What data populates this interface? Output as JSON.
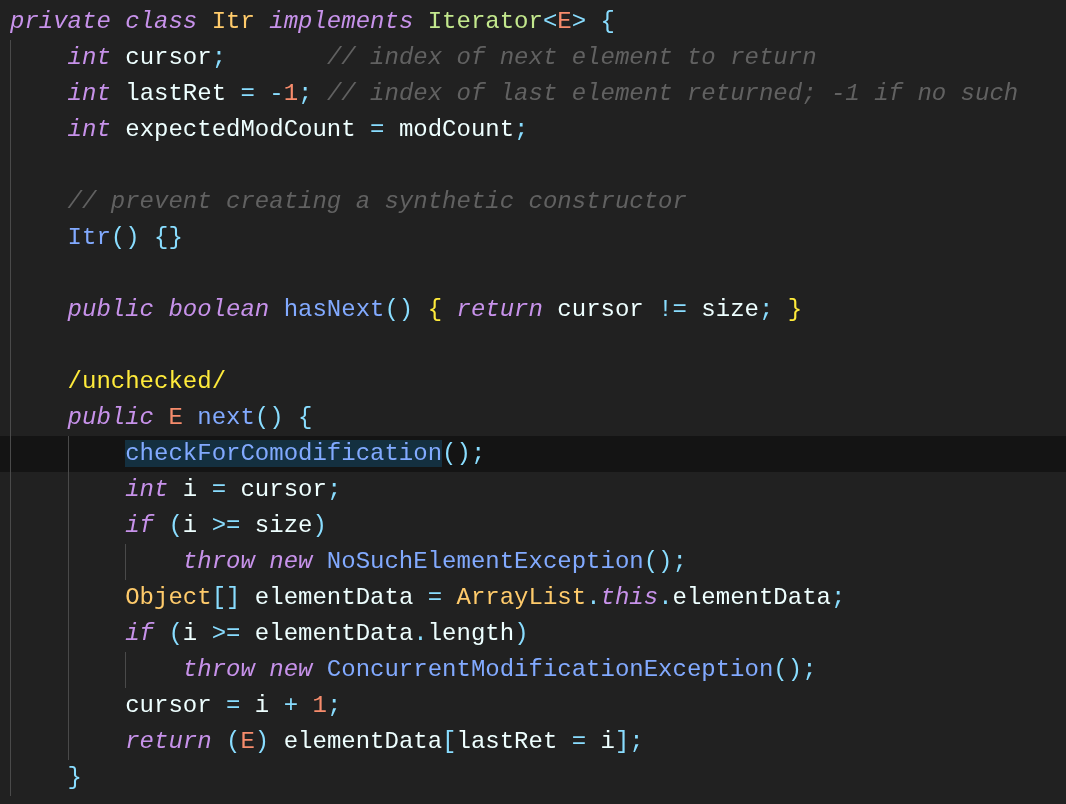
{
  "editor": {
    "lines": [
      {
        "highlighted": false,
        "tokens": [
          {
            "text": "private",
            "kind": "keyword"
          },
          {
            "text": " class",
            "kind": "keyword"
          },
          {
            "text": " Itr",
            "kind": "class"
          },
          {
            "text": " implements",
            "kind": "keyword"
          },
          {
            "text": " Iterator",
            "kind": "interface"
          },
          {
            "text": "<",
            "kind": "punct"
          },
          {
            "text": "E",
            "kind": "literal"
          },
          {
            "text": ">",
            "kind": "punct"
          },
          {
            "text": " {",
            "kind": "punct"
          }
        ]
      },
      {
        "highlighted": false,
        "tokens": [
          {
            "text": "    int",
            "kind": "keyword"
          },
          {
            "text": " cursor",
            "kind": "plain"
          },
          {
            "text": ";",
            "kind": "punct"
          },
          {
            "text": "       // index of next element to return",
            "kind": "comment"
          }
        ]
      },
      {
        "highlighted": false,
        "tokens": [
          {
            "text": "    int",
            "kind": "keyword"
          },
          {
            "text": " lastRet ",
            "kind": "plain"
          },
          {
            "text": "= -",
            "kind": "punct"
          },
          {
            "text": "1",
            "kind": "literal"
          },
          {
            "text": ";",
            "kind": "punct"
          },
          {
            "text": " // index of last element returned; -1 if no such",
            "kind": "comment"
          }
        ]
      },
      {
        "highlighted": false,
        "tokens": [
          {
            "text": "    int",
            "kind": "keyword"
          },
          {
            "text": " expectedModCount ",
            "kind": "plain"
          },
          {
            "text": "=",
            "kind": "punct"
          },
          {
            "text": " modCount",
            "kind": "plain"
          },
          {
            "text": ";",
            "kind": "punct"
          }
        ]
      },
      {
        "highlighted": false
      },
      {
        "highlighted": false,
        "tokens": [
          {
            "text": "    // prevent creating a synthetic constructor",
            "kind": "comment"
          }
        ]
      },
      {
        "highlighted": false,
        "tokens": [
          {
            "text": "    Itr",
            "kind": "function"
          },
          {
            "text": "() {}",
            "kind": "punct"
          }
        ]
      },
      {
        "highlighted": false
      },
      {
        "highlighted": false,
        "tokens": [
          {
            "text": "    public",
            "kind": "keyword"
          },
          {
            "text": " boolean",
            "kind": "keyword"
          },
          {
            "text": " hasNext",
            "kind": "function"
          },
          {
            "text": "()",
            "kind": "punct"
          },
          {
            "text": " {",
            "kind": "bracket"
          },
          {
            "text": " return",
            "kind": "keyword"
          },
          {
            "text": " cursor ",
            "kind": "plain"
          },
          {
            "text": "!=",
            "kind": "punct"
          },
          {
            "text": " size",
            "kind": "plain"
          },
          {
            "text": ";",
            "kind": "punct"
          },
          {
            "text": " }",
            "kind": "bracket"
          }
        ]
      },
      {
        "highlighted": false
      },
      {
        "highlighted": false,
        "tokens": [
          {
            "text": "    /unchecked/",
            "kind": "bracket"
          }
        ]
      },
      {
        "highlighted": false,
        "tokens": [
          {
            "text": "    public",
            "kind": "keyword"
          },
          {
            "text": " E",
            "kind": "literal"
          },
          {
            "text": " next",
            "kind": "function"
          },
          {
            "text": "() {",
            "kind": "punct"
          }
        ]
      },
      {
        "highlighted": true,
        "tokens": [
          {
            "text": "        checkForComodification",
            "kind": "function",
            "selected": true
          },
          {
            "text": "();",
            "kind": "punct",
            "selected": false
          }
        ]
      },
      {
        "highlighted": false,
        "tokens": [
          {
            "text": "        int",
            "kind": "keyword"
          },
          {
            "text": " i ",
            "kind": "plain"
          },
          {
            "text": "=",
            "kind": "punct"
          },
          {
            "text": " cursor",
            "kind": "plain"
          },
          {
            "text": ";",
            "kind": "punct"
          }
        ]
      },
      {
        "highlighted": false,
        "tokens": [
          {
            "text": "        if",
            "kind": "keyword"
          },
          {
            "text": " (",
            "kind": "punct"
          },
          {
            "text": "i ",
            "kind": "plain"
          },
          {
            "text": ">=",
            "kind": "punct"
          },
          {
            "text": " size",
            "kind": "plain"
          },
          {
            "text": ")",
            "kind": "punct"
          }
        ]
      },
      {
        "highlighted": false,
        "tokens": [
          {
            "text": "            throw",
            "kind": "keyword"
          },
          {
            "text": " new",
            "kind": "keyword"
          },
          {
            "text": " NoSuchElementException",
            "kind": "function"
          },
          {
            "text": "();",
            "kind": "punct"
          }
        ]
      },
      {
        "highlighted": false,
        "tokens": [
          {
            "text": "        Object",
            "kind": "class"
          },
          {
            "text": "[]",
            "kind": "punct"
          },
          {
            "text": " elementData ",
            "kind": "plain"
          },
          {
            "text": "=",
            "kind": "punct"
          },
          {
            "text": " ArrayList",
            "kind": "class"
          },
          {
            "text": ".",
            "kind": "punct"
          },
          {
            "text": "this",
            "kind": "keyword"
          },
          {
            "text": ".",
            "kind": "punct"
          },
          {
            "text": "elementData",
            "kind": "plain"
          },
          {
            "text": ";",
            "kind": "punct"
          }
        ]
      },
      {
        "highlighted": false,
        "tokens": [
          {
            "text": "        if",
            "kind": "keyword"
          },
          {
            "text": " (",
            "kind": "punct"
          },
          {
            "text": "i ",
            "kind": "plain"
          },
          {
            "text": ">=",
            "kind": "punct"
          },
          {
            "text": " elementData",
            "kind": "plain"
          },
          {
            "text": ".",
            "kind": "punct"
          },
          {
            "text": "length",
            "kind": "plain"
          },
          {
            "text": ")",
            "kind": "punct"
          }
        ]
      },
      {
        "highlighted": false,
        "tokens": [
          {
            "text": "            throw",
            "kind": "keyword"
          },
          {
            "text": " new",
            "kind": "keyword"
          },
          {
            "text": " ConcurrentModificationException",
            "kind": "function"
          },
          {
            "text": "();",
            "kind": "punct"
          }
        ]
      },
      {
        "highlighted": false,
        "tokens": [
          {
            "text": "        cursor ",
            "kind": "plain"
          },
          {
            "text": "=",
            "kind": "punct"
          },
          {
            "text": " i ",
            "kind": "plain"
          },
          {
            "text": "+",
            "kind": "punct"
          },
          {
            "text": " 1",
            "kind": "literal"
          },
          {
            "text": ";",
            "kind": "punct"
          }
        ]
      },
      {
        "highlighted": false,
        "tokens": [
          {
            "text": "        return",
            "kind": "keyword"
          },
          {
            "text": " (",
            "kind": "punct"
          },
          {
            "text": "E",
            "kind": "literal"
          },
          {
            "text": ")",
            "kind": "punct"
          },
          {
            "text": " elementData",
            "kind": "plain"
          },
          {
            "text": "[",
            "kind": "punct"
          },
          {
            "text": "lastRet ",
            "kind": "plain"
          },
          {
            "text": "=",
            "kind": "punct"
          },
          {
            "text": " i",
            "kind": "plain"
          },
          {
            "text": "];",
            "kind": "punct"
          }
        ]
      },
      {
        "highlighted": false,
        "tokens": [
          {
            "text": "    }",
            "kind": "punct"
          }
        ]
      }
    ]
  }
}
